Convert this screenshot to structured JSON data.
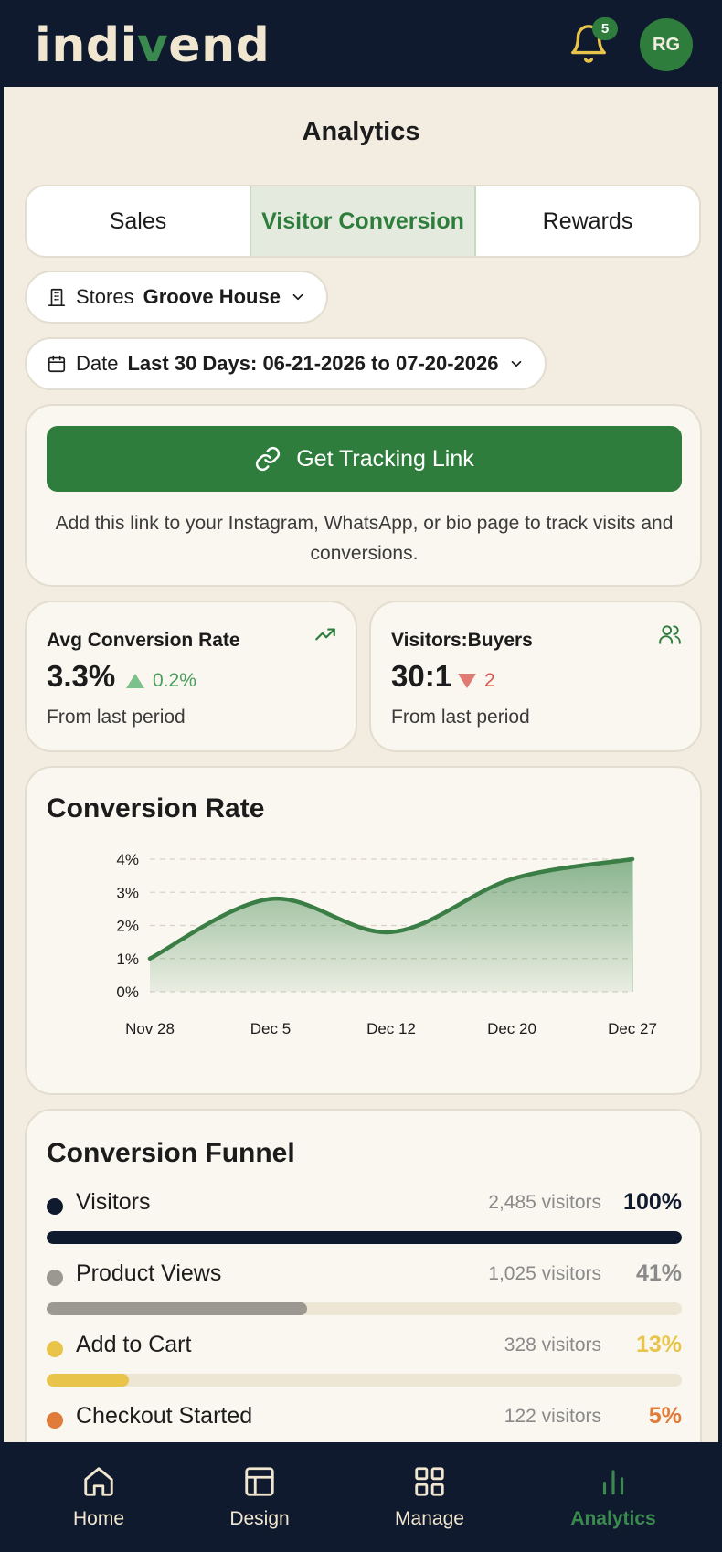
{
  "header": {
    "logo_pre": "indi",
    "logo_v": "v",
    "logo_post": "end",
    "notification_count": "5",
    "avatar_initials": "RG"
  },
  "page": {
    "title": "Analytics"
  },
  "tabs": [
    {
      "label": "Sales",
      "active": false
    },
    {
      "label": "Visitor Conversion",
      "active": true
    },
    {
      "label": "Rewards",
      "active": false
    }
  ],
  "filters": {
    "store": {
      "label": "Stores",
      "value": "Groove House"
    },
    "date": {
      "label": "Date",
      "value": "Last 30 Days: 06-21-2026 to 07-20-2026"
    }
  },
  "tracking": {
    "button_label": "Get Tracking Link",
    "note": "Add this link to your Instagram, WhatsApp, or bio page to track visits and conversions."
  },
  "stats": [
    {
      "title": "Avg Conversion Rate",
      "value": "3.3%",
      "delta": "0.2%",
      "direction": "up",
      "sub": "From last period",
      "icon": "trending-up-icon"
    },
    {
      "title": "Visitors:Buyers",
      "value": "30:1",
      "delta": "2",
      "direction": "down",
      "sub": "From last period",
      "icon": "users-icon"
    }
  ],
  "conversion_chart": {
    "title": "Conversion Rate"
  },
  "chart_data": {
    "type": "area",
    "title": "Conversion Rate",
    "x": [
      "Nov 28",
      "Dec 5",
      "Dec 12",
      "Dec 20",
      "Dec 27"
    ],
    "y_ticks": [
      "0%",
      "1%",
      "2%",
      "3%",
      "4%"
    ],
    "ylim": [
      0,
      4
    ],
    "grid": true,
    "series": [
      {
        "values": [
          1.0,
          2.8,
          1.8,
          3.4,
          4.0
        ]
      }
    ]
  },
  "funnel": {
    "title": "Conversion Funnel",
    "items": [
      {
        "name": "Visitors",
        "count": "2,485 visitors",
        "pct": "100%",
        "fraction": 1.0,
        "color": "#0f1a2e"
      },
      {
        "name": "Product Views",
        "count": "1,025 visitors",
        "pct": "41%",
        "fraction": 0.41,
        "color": "#9b9891"
      },
      {
        "name": "Add to Cart",
        "count": "328 visitors",
        "pct": "13%",
        "fraction": 0.13,
        "color": "#e9c44a"
      },
      {
        "name": "Checkout Started",
        "count": "122 visitors",
        "pct": "5%",
        "fraction": 0.05,
        "color": "#e07b39"
      }
    ]
  },
  "colors": {
    "brand_green": "#2e7d3d",
    "navy": "#0f1a2e",
    "up": "#7cc18c",
    "down": "#e07a72"
  },
  "nav": [
    {
      "label": "Home",
      "icon": "home-icon",
      "active": false
    },
    {
      "label": "Design",
      "icon": "layout-icon",
      "active": false
    },
    {
      "label": "Manage",
      "icon": "grid-icon",
      "active": false
    },
    {
      "label": "Analytics",
      "icon": "bar-chart-icon",
      "active": true
    }
  ]
}
